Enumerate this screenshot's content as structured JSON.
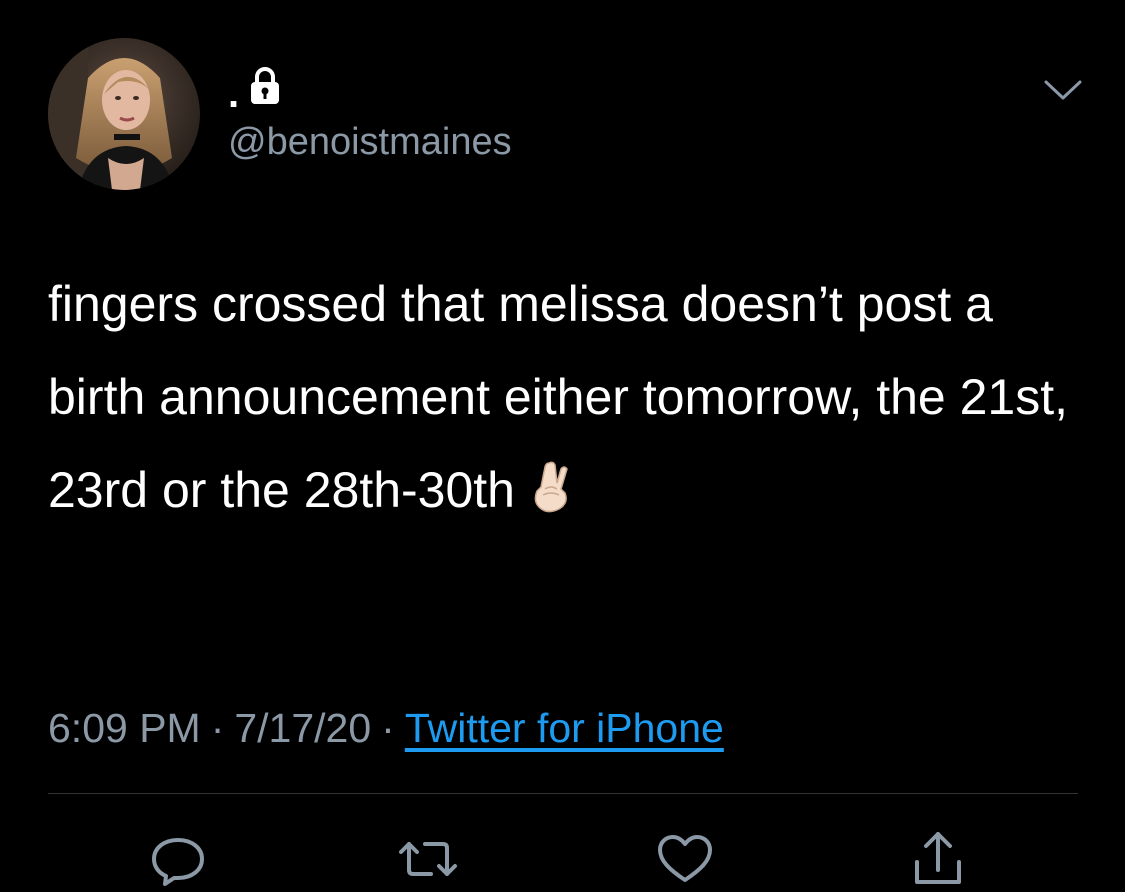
{
  "user": {
    "display_name": ".",
    "handle": "@benoistmaines",
    "avatar_icon": "profile-photo",
    "lock_icon": "lock-icon"
  },
  "tweet": {
    "text": "fingers crossed that melissa doesn’t post a birth announcement either tomorrow, the 21st, 23rd or the 28th-30th",
    "emoji": "🤞🏻",
    "time": "6:09 PM",
    "date": "7/17/20",
    "separator": "·",
    "source": "Twitter for iPhone"
  },
  "actions": {
    "reply_icon": "reply-icon",
    "retweet_icon": "retweet-icon",
    "like_icon": "heart-icon",
    "share_icon": "share-icon"
  },
  "colors": {
    "background": "#000000",
    "text": "#ffffff",
    "secondary": "#8b98a5",
    "link": "#1d9bf0",
    "divider": "#2f3336"
  }
}
